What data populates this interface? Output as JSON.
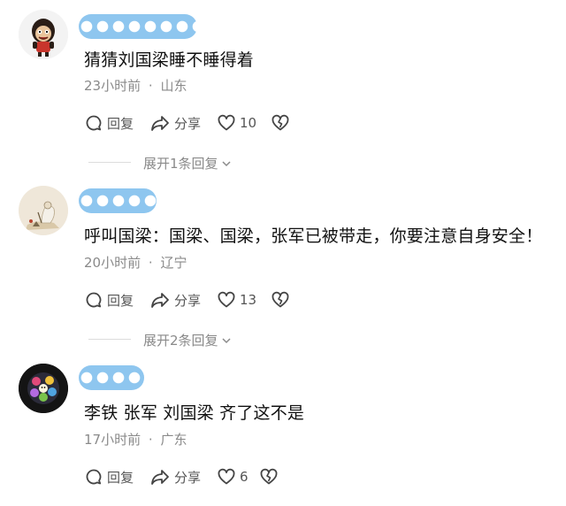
{
  "comments": [
    {
      "text": "猜猜刘国梁睡不睡得着",
      "time": "23小时前",
      "location": "山东",
      "reply_label": "回复",
      "share_label": "分享",
      "likes": "10",
      "expand_label": "展开1条回复"
    },
    {
      "text": "呼叫国梁：国梁、国梁，张军已被带走，你要注意自身安全！",
      "time": "20小时前",
      "location": "辽宁",
      "reply_label": "回复",
      "share_label": "分享",
      "likes": "13",
      "expand_label": "展开2条回复"
    },
    {
      "text": "李铁 张军 刘国梁 齐了这不是",
      "time": "17小时前",
      "location": "广东",
      "reply_label": "回复",
      "share_label": "分享",
      "likes": "6"
    }
  ],
  "meta_separator": "·",
  "colors": {
    "name_mask": "#8ec6ef",
    "meta_text": "#8a8a8a",
    "action_icon": "#555555"
  },
  "icons": {
    "reply": "speech-bubble-icon",
    "share": "share-arrow-icon",
    "like": "heart-icon",
    "dislike": "broken-heart-icon",
    "expand": "chevron-down-icon"
  }
}
